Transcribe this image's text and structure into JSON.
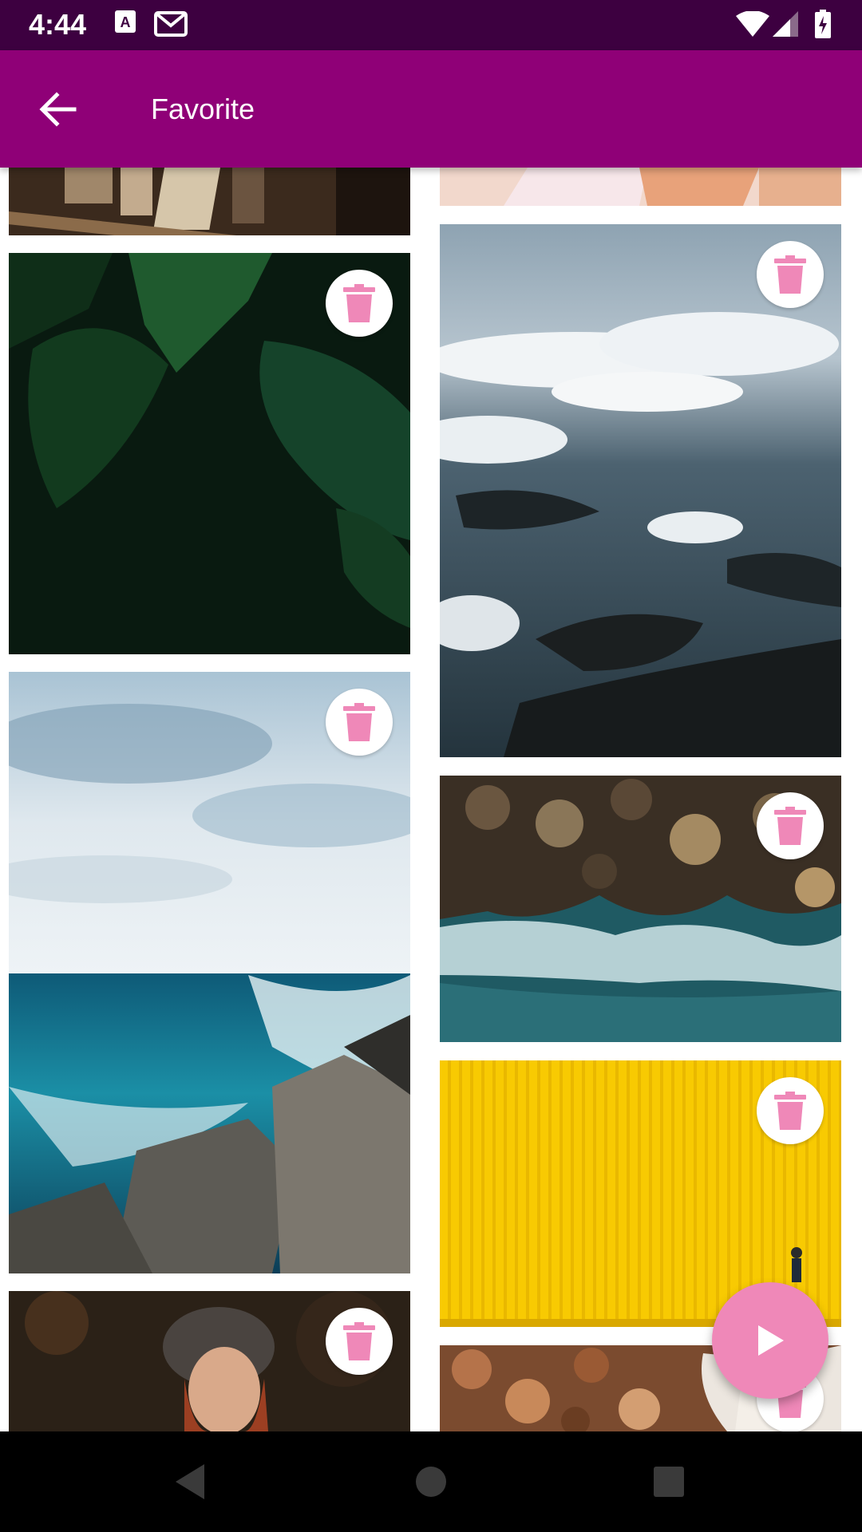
{
  "status_bar": {
    "time": "4:44",
    "icons": [
      "keyboard-a-icon",
      "gmail-icon",
      "wifi-icon",
      "signal-icon",
      "battery-icon"
    ]
  },
  "app_bar": {
    "title": "Favorite",
    "back_icon": "arrow-back-icon",
    "background": "#8f0077"
  },
  "gallery": {
    "delete_icon": "trash-icon",
    "delete_icon_color": "#ef88b8",
    "items": [
      {
        "name": "photo-books",
        "has_delete_button": false
      },
      {
        "name": "photo-portrait-top",
        "has_delete_button": false
      },
      {
        "name": "photo-green-leaves",
        "has_delete_button": true
      },
      {
        "name": "photo-aerial-clouds",
        "has_delete_button": true
      },
      {
        "name": "photo-ocean-rocks",
        "has_delete_button": true
      },
      {
        "name": "photo-rocky-shore",
        "has_delete_button": true
      },
      {
        "name": "photo-yellow-wall",
        "has_delete_button": true
      },
      {
        "name": "photo-girl-hat",
        "has_delete_button": true
      },
      {
        "name": "photo-autumn-leaves",
        "has_delete_button": true
      }
    ]
  },
  "fab": {
    "icon": "play-icon",
    "color": "#ef88b8"
  },
  "nav_bar": {
    "icons": [
      "nav-back-icon",
      "nav-home-icon",
      "nav-recents-icon"
    ]
  }
}
